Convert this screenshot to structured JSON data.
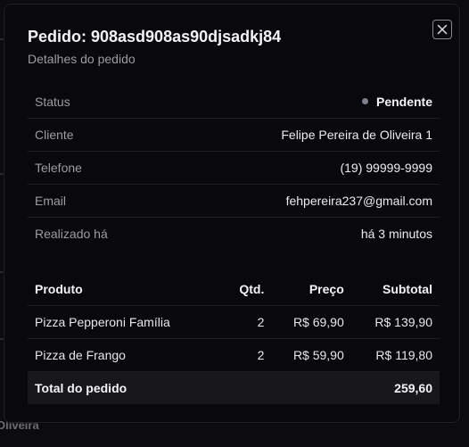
{
  "background": {
    "partial_text": "Oliveira"
  },
  "modal": {
    "title": "Pedido: 908asd908as90djsadkj84",
    "subtitle": "Detalhes do pedido",
    "close_icon": "close-icon"
  },
  "details": [
    {
      "label": "Status",
      "value": "Pendente",
      "status_color": "#7c8290"
    },
    {
      "label": "Cliente",
      "value": "Felipe Pereira de Oliveira 1"
    },
    {
      "label": "Telefone",
      "value": "(19) 99999-9999"
    },
    {
      "label": "Email",
      "value": "fehpereira237@gmail.com"
    },
    {
      "label": "Realizado há",
      "value": "há 3 minutos"
    }
  ],
  "table": {
    "headers": {
      "product": "Produto",
      "qty": "Qtd.",
      "price": "Preço",
      "subtotal": "Subtotal"
    },
    "rows": [
      {
        "product": "Pizza Pepperoni Família",
        "qty": "2",
        "price": "R$ 69,90",
        "subtotal": "R$ 139,90"
      },
      {
        "product": "Pizza de Frango",
        "qty": "2",
        "price": "R$ 59,90",
        "subtotal": "R$ 119,80"
      }
    ],
    "total_label": "Total do pedido",
    "total_value": "259,60"
  }
}
